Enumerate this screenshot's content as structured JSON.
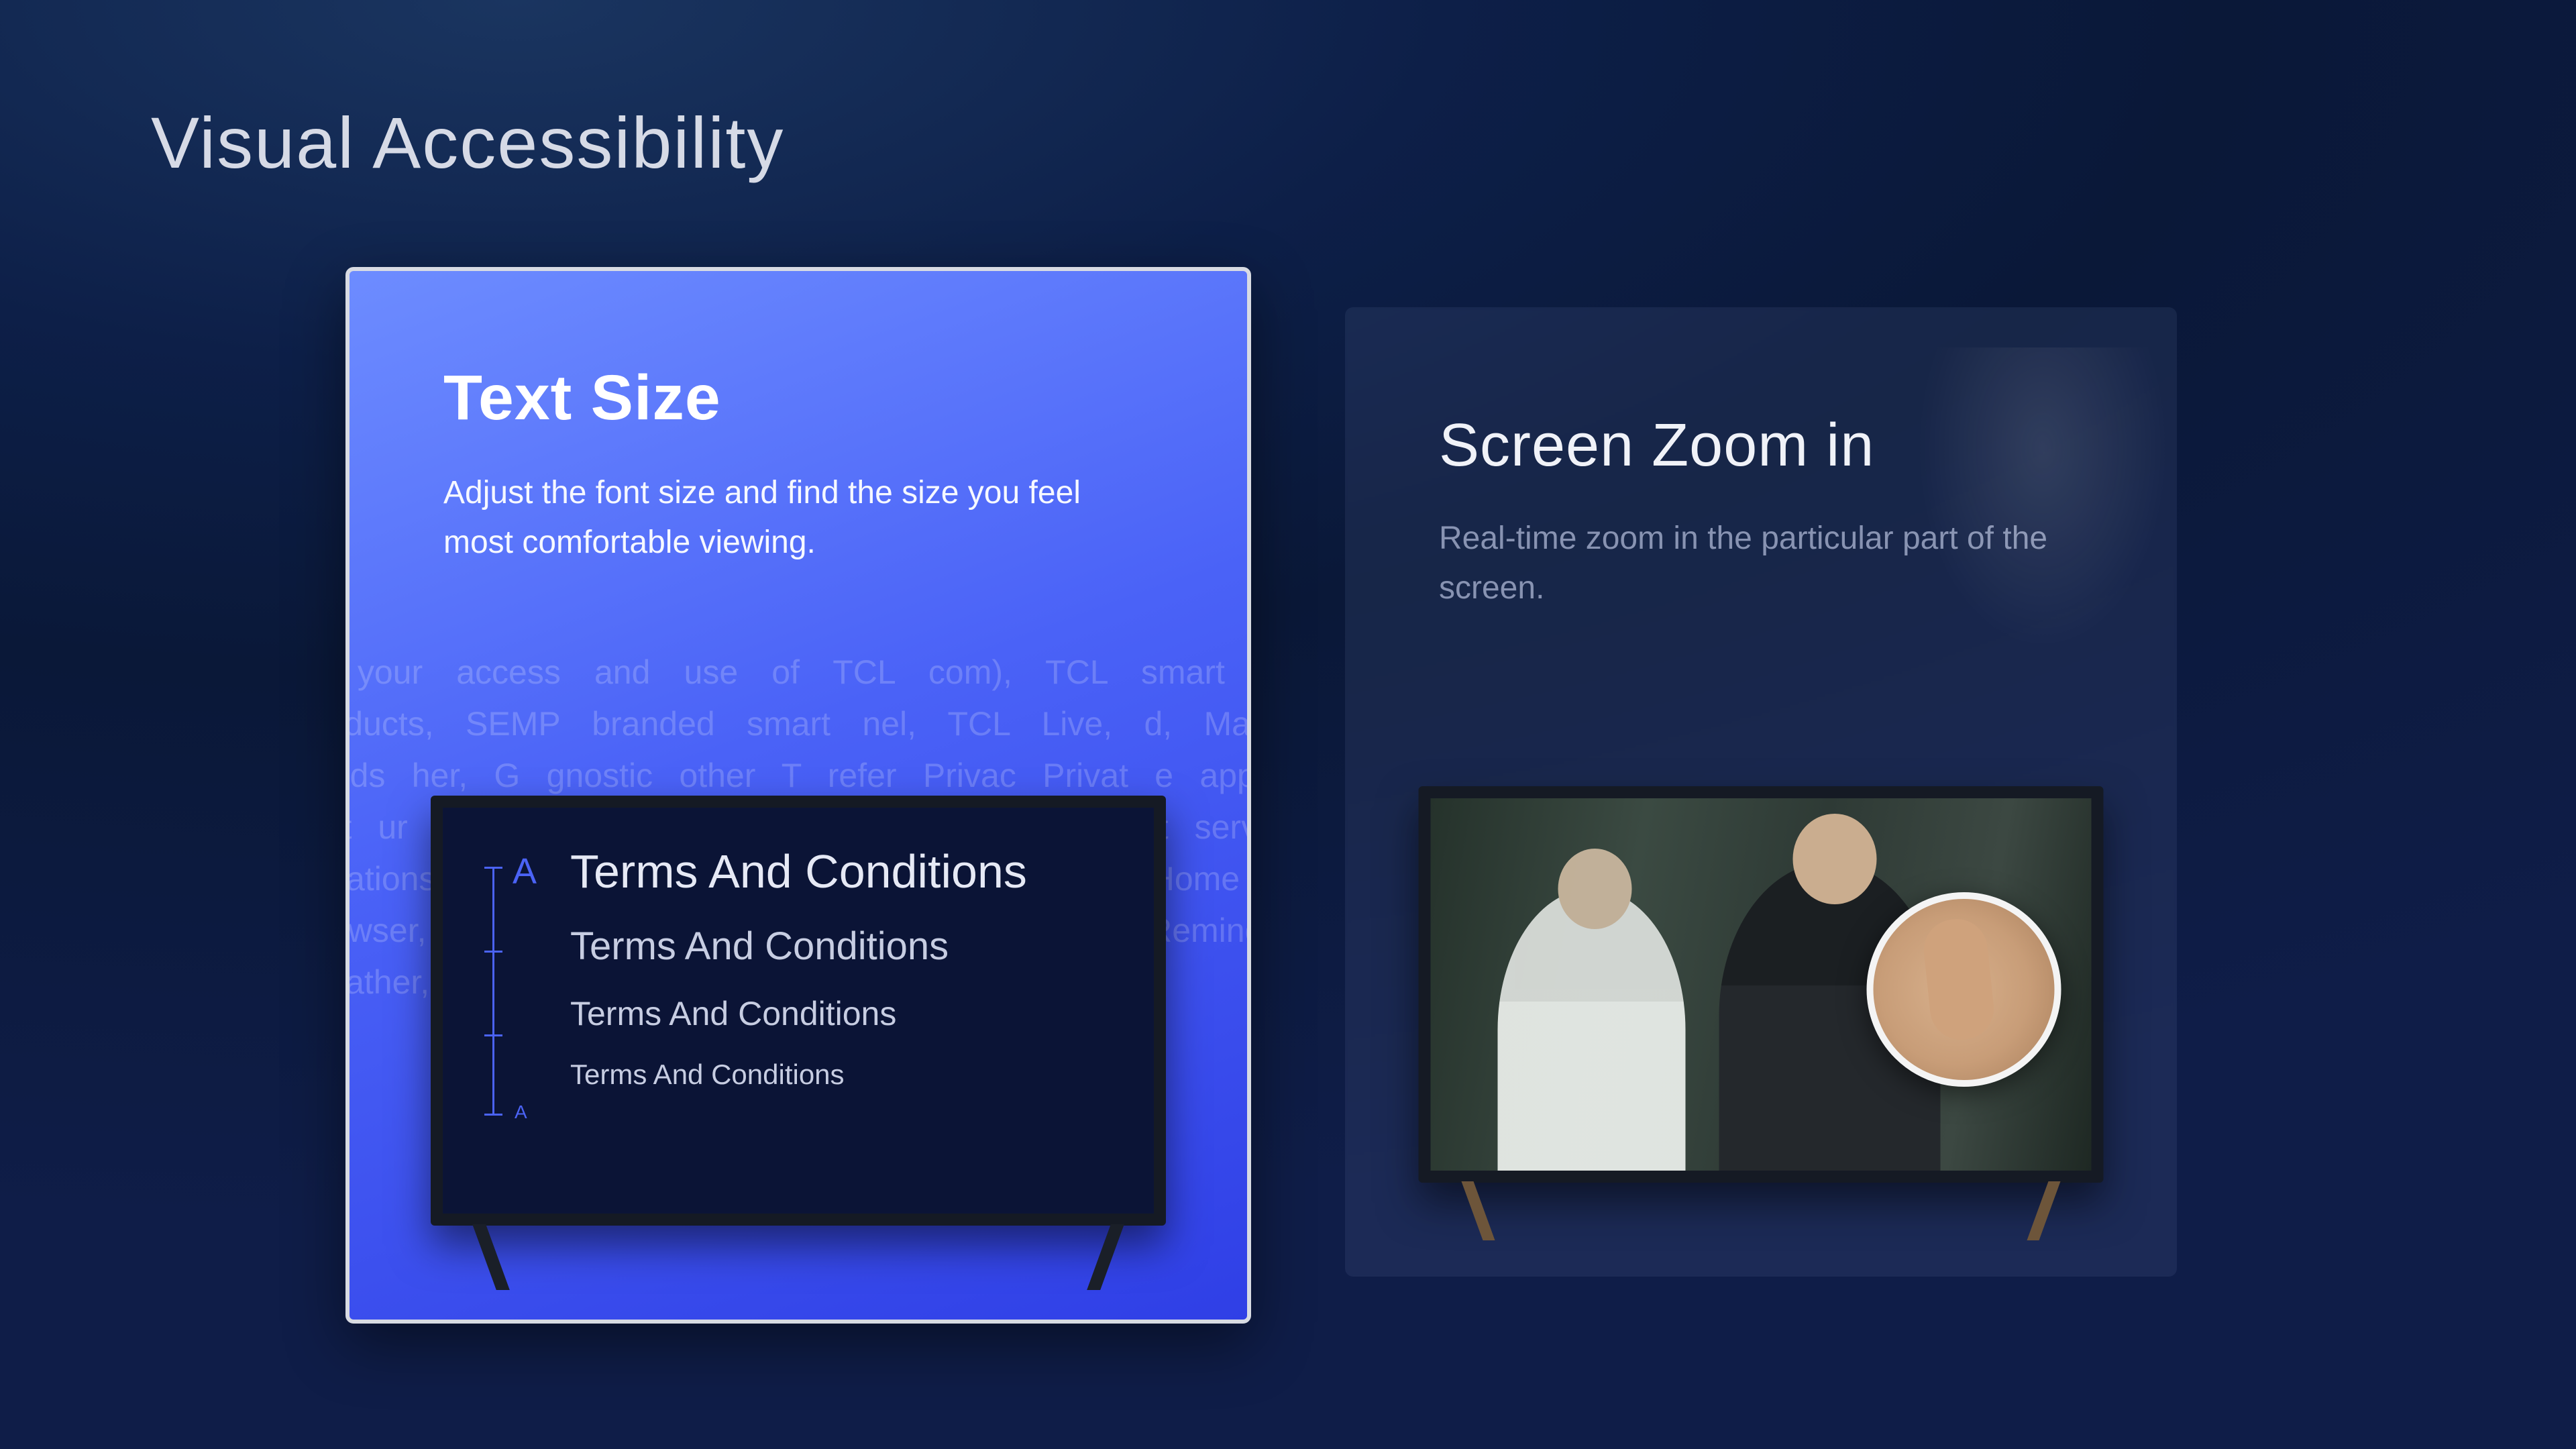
{
  "page_title": "Visual Accessibility",
  "cards": {
    "text_size": {
      "title": "Text Size",
      "description": "Adjust the font size and find the size you feel most comfortable viewing.",
      "sample_line": "Terms And Conditions",
      "slider_marker_big": "A",
      "slider_marker_small": "A",
      "background_text": "of your access and use of TCL com), TCL smart TV products, SEMP branded smart nel, TCL Live, d, MagiC minds her, G gnostic other T refer Privac Privat e app a rest ur acc product P branded devices, TCL smart service plications ing TCL Account, TCL Channel, TCL Home T-Browser, TCL Live, TV Guard, MagiCom Reminder, Weather, Gen"
    },
    "screen_zoom": {
      "title": "Screen Zoom in",
      "description": "Real-time zoom in the particular part of the screen."
    }
  }
}
